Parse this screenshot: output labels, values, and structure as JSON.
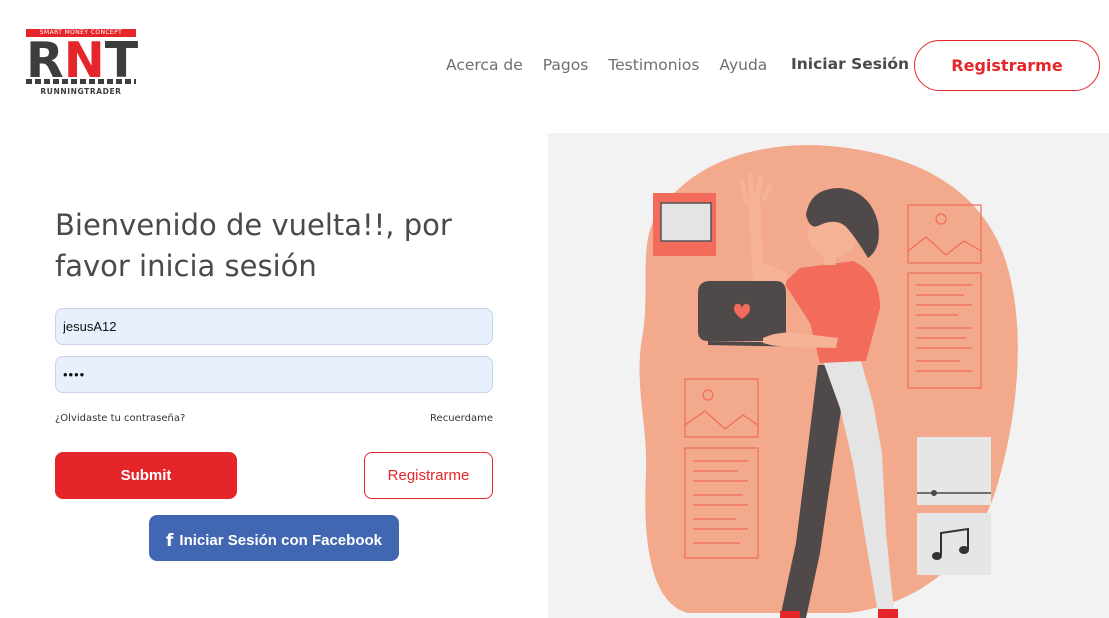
{
  "logo": {
    "tagline": "SMART MONEY CONCEPT",
    "letters": [
      "R",
      "N",
      "T"
    ],
    "subtitle": "RUNNINGTRADER"
  },
  "nav": {
    "links": [
      "Acerca de",
      "Pagos",
      "Testimonios",
      "Ayuda"
    ],
    "login_label": "Iniciar Sesión",
    "register_label": "Registrarme"
  },
  "login": {
    "heading": "Bienvenido de vuelta!!, por favor inicia sesión",
    "username_value": "jesusA12",
    "password_value": "••••",
    "forgot_label": "¿Olvidaste tu contraseña?",
    "remember_label": "Recuerdame",
    "submit_label": "Submit",
    "register_label": "Registrarme",
    "facebook_label": "Iniciar Sesión con Facebook",
    "facebook_icon": "f"
  },
  "colors": {
    "accent": "#e4262b",
    "facebook": "#4267b2",
    "input_bg": "#e8f0fe",
    "illustration_blob": "#f2a98c"
  },
  "illustration": {
    "icons": [
      "photo-frame-icon",
      "landscape-image-icon",
      "document-icon",
      "music-note-icon",
      "slider-card-icon",
      "laptop-icon",
      "heart-icon"
    ]
  }
}
